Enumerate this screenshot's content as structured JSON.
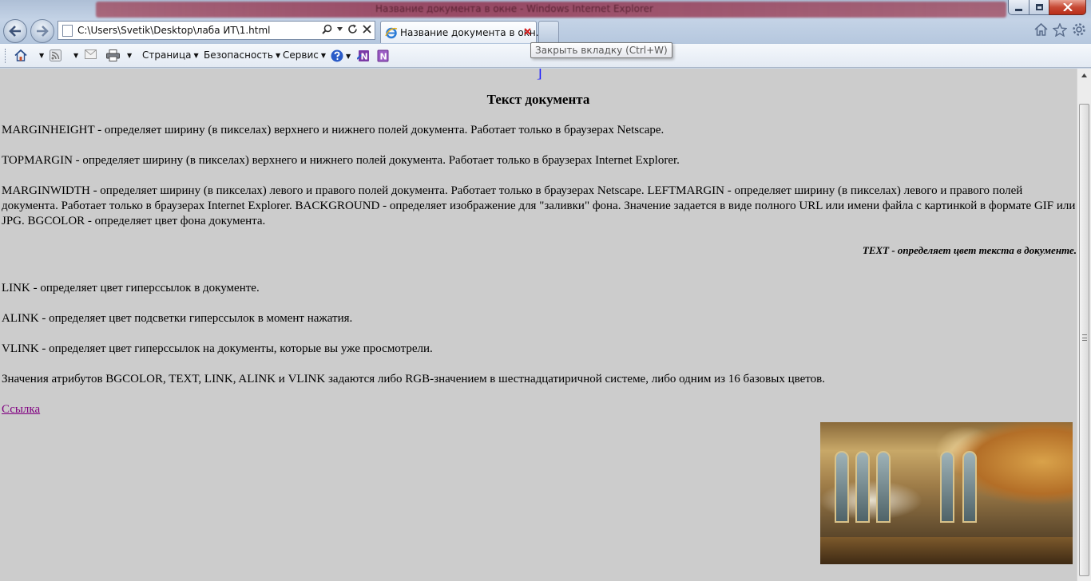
{
  "window": {
    "title_blurred": "Название документа в окне - Windows Internet Explorer",
    "minimize_glyph": "—",
    "maximize_glyph": "❐",
    "close_glyph": "✕"
  },
  "address_bar": {
    "url": "C:\\Users\\Svetik\\Desktop\\лаба ИТ\\1.html"
  },
  "tab": {
    "label": "Название документа в окн..."
  },
  "tooltip": "Закрыть вкладку (Ctrl+W)",
  "command_bar": {
    "page": "Страница",
    "security": "Безопасность",
    "tools": "Сервис"
  },
  "document": {
    "heading": "Текст документа",
    "paragraphs": [
      "MARGINHEIGHT - определяет ширину (в пикселах) верхнего и нижнего полей документа. Работает только в браузерах Netscape.",
      "TOPMARGIN - определяет ширину (в пикселах) верхнего и нижнего полей документа. Работает только в браузерах Internet Explorer.",
      "MARGINWIDTH - определяет ширину (в пикселах) левого и правого полей документа. Работает только в браузерах Netscape. LEFTMARGIN - определяет ширину (в пикселах) левого и правого полей документа. Работает только в браузерах Internet Explorer. BACKGROUND - определяет изображение для \"заливки\" фона. Значение задается в виде полного URL или имени файла с картинкой в формате GIF или JPG. BGCOLOR - определяет цвет фона документа."
    ],
    "italic_right": "TEXT - определяет цвет текста в документе.",
    "paragraphs2": [
      "LINK - определяет цвет гиперссылок в документе.",
      "ALINK - определяет цвет подсветки гиперссылок в момент нажатия.",
      "VLINK - определяет цвет гиперссылок на документы, которые вы уже просмотрели.",
      "Значения атрибутов BGCOLOR, TEXT, LINK, ALINK и VLINK задаются либо RGB-значением в шестнадцатиричной системе, либо одним из 16 базовых цветов."
    ],
    "link": "Ссылка",
    "background_color": "#cccccc",
    "link_color": "#800080"
  },
  "icons": {
    "back": "back-arrow-icon",
    "forward": "forward-arrow-icon",
    "home": "home-icon",
    "favorites": "star-icon",
    "settings": "gear-icon"
  }
}
